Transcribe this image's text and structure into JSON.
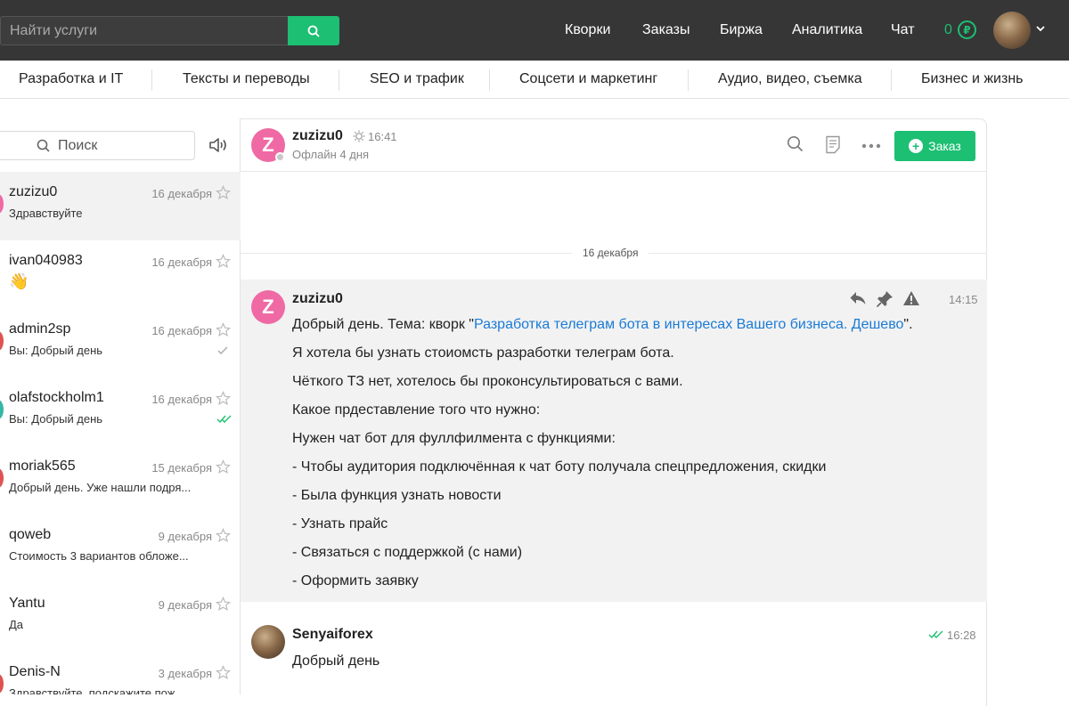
{
  "topbar": {
    "search_placeholder": "Найти услуги",
    "nav": [
      "Кворки",
      "Заказы",
      "Биржа",
      "Аналитика",
      "Чат"
    ],
    "balance": "0",
    "currency_symbol": "₽"
  },
  "categories": [
    "Разработка и IT",
    "Тексты и переводы",
    "SEO и трафик",
    "Соцсети и маркетинг",
    "Аудио, видео, съемка",
    "Бизнес и жизнь"
  ],
  "sidebar": {
    "search_label": "Поиск",
    "conversations": [
      {
        "name": "zuzizu0",
        "date": "16 декабря",
        "preview": "Здравствуйте",
        "color": "#ef6aa4"
      },
      {
        "name": "ivan040983",
        "date": "16 декабря",
        "preview": "👋",
        "color": ""
      },
      {
        "name": "admin2sp",
        "date": "16 декабря",
        "preview": "Вы: Добрый день",
        "color": "#e05252"
      },
      {
        "name": "olafstockholm1",
        "date": "16 декабря",
        "preview": "Вы: Добрый день",
        "color": "#35b7a6"
      },
      {
        "name": "moriak565",
        "date": "15 декабря",
        "preview": "Добрый день. Уже нашли подря...",
        "color": "#e05252"
      },
      {
        "name": "qoweb",
        "date": "9 декабря",
        "preview": "Стоимость 3 вариантов обложе...",
        "color": ""
      },
      {
        "name": "Yantu",
        "date": "9 декабря",
        "preview": "Да",
        "color": ""
      },
      {
        "name": "Denis-N",
        "date": "3 декабря",
        "preview": "Здравствуйте, подскажите пож...",
        "color": "#e05252"
      }
    ]
  },
  "chat": {
    "header": {
      "avatar_letter": "Z",
      "name": "zuzizu0",
      "local_time": "16:41",
      "status": "Офлайн 4 дня",
      "order_label": "Заказ"
    },
    "date_separator": "16 декабря",
    "message1": {
      "avatar_letter": "Z",
      "author": "zuzizu0",
      "time": "14:15",
      "line1_prefix": "Добрый день. Тема: кворк \"",
      "line1_link": "Разработка телеграм бота в интересах Вашего бизнеса. Дешево",
      "line1_suffix": "\".",
      "lines": [
        "Я хотела бы узнать стоиомсть разработки телеграм бота.",
        "Чёткого ТЗ нет, хотелось бы проконсультироваться с вами.",
        "Какое прдеставление того что нужно:",
        "Нужен чат бот для фуллфилмента с функциями:",
        "- Чтобы аудитория подключённая к чат боту получала спецпредложения, скидки",
        "- Была функция узнать новости",
        "- Узнать прайс",
        "- Связаться с поддержкой (с нами)",
        "- Оформить заявку"
      ]
    },
    "message2": {
      "author": "Senyaiforex",
      "time": "16:28",
      "text": "Добрый день"
    }
  },
  "colors": {
    "accent": "#1dbf73",
    "link": "#1a7bd6",
    "avatar_pink": "#ef6aa4",
    "topbar": "#363636"
  }
}
